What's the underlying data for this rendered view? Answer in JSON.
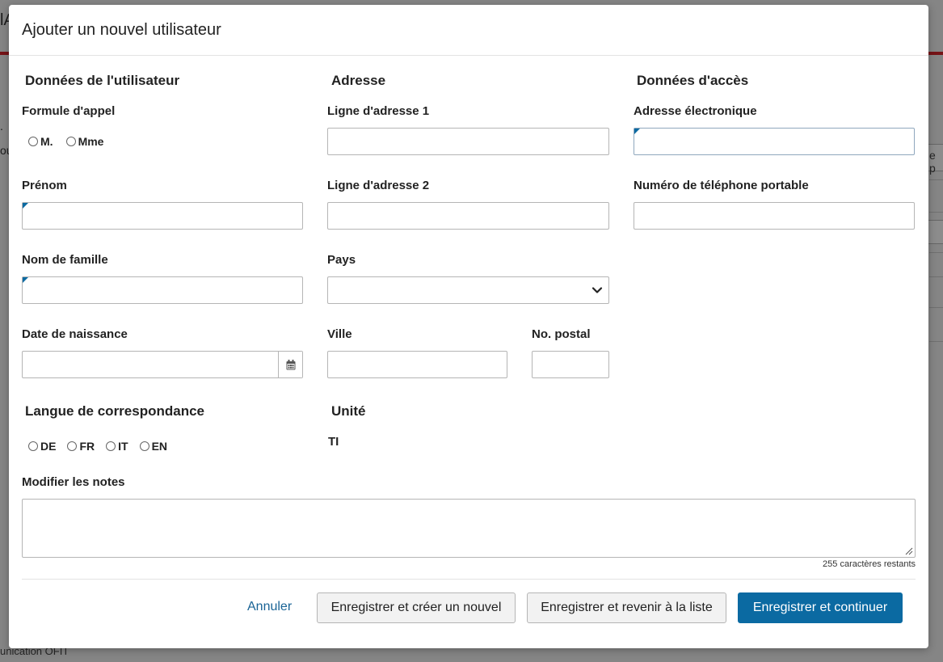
{
  "background": {
    "title_fragment": "lA",
    "footer_fragment": "unication OFIT",
    "side_fragment": "e p",
    "left_dot": ".",
    "left_fragment": "ou"
  },
  "modal": {
    "title": "Ajouter un nouvel utilisateur"
  },
  "user_data": {
    "section_title": "Données de l'utilisateur",
    "salutation_label": "Formule d'appel",
    "salutation_options": [
      "M.",
      "Mme"
    ],
    "first_name_label": "Prénom",
    "first_name_value": "",
    "last_name_label": "Nom de famille",
    "last_name_value": "",
    "birth_date_label": "Date de naissance",
    "birth_date_value": ""
  },
  "address": {
    "section_title": "Adresse",
    "line1_label": "Ligne d'adresse 1",
    "line1_value": "",
    "line2_label": "Ligne d'adresse 2",
    "line2_value": "",
    "country_label": "Pays",
    "country_value": "",
    "city_label": "Ville",
    "city_value": "",
    "postal_label": "No. postal",
    "postal_value": ""
  },
  "access": {
    "section_title": "Données d'accès",
    "email_label": "Adresse électronique",
    "email_value": "",
    "mobile_label": "Numéro de téléphone portable",
    "mobile_value": ""
  },
  "language": {
    "section_title": "Langue de correspondance",
    "options": [
      "DE",
      "FR",
      "IT",
      "EN"
    ]
  },
  "unit": {
    "section_title": "Unité",
    "value": "TI"
  },
  "notes": {
    "label": "Modifier les notes",
    "value": "",
    "chars_remaining": "255 caractères restants"
  },
  "footer": {
    "cancel": "Annuler",
    "save_new": "Enregistrer et créer un nouvel",
    "save_list": "Enregistrer et revenir à la liste",
    "save_continue": "Enregistrer et continuer"
  },
  "colors": {
    "primary": "#0b6aa2",
    "link": "#1a6496",
    "required_marker": "#0b6aa2",
    "brand_red": "#d8232a"
  },
  "icons": {
    "calendar": "calendar-icon",
    "chevron": "chevron-down-icon",
    "resize": "resize-grip-icon"
  }
}
